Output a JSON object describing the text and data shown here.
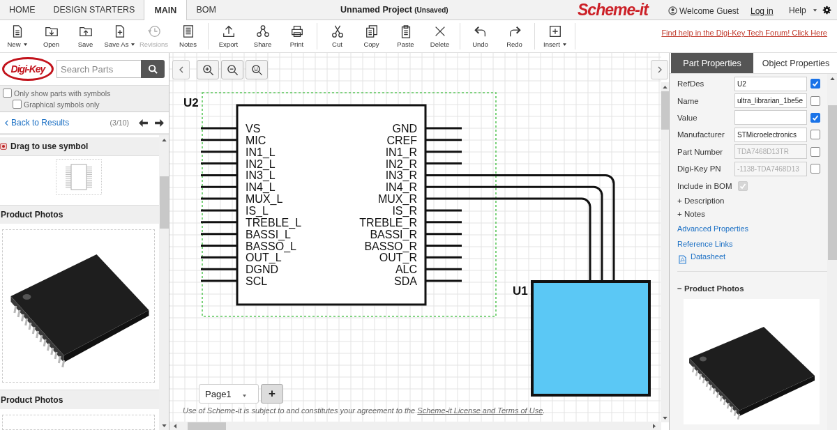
{
  "top_tabs": [
    {
      "label": "HOME",
      "selected": false
    },
    {
      "label": "DESIGN STARTERS",
      "selected": false
    },
    {
      "label": "MAIN",
      "selected": true
    },
    {
      "label": "BOM",
      "selected": false
    }
  ],
  "project": {
    "title": "Unnamed Project",
    "status": "(Unsaved)"
  },
  "app_logo": "Scheme-it",
  "user": {
    "welcome": "Welcome Guest",
    "login": "Log in",
    "help": "Help"
  },
  "toolbar": [
    [
      {
        "label": "New",
        "kind": "new",
        "has_menu": true,
        "disabled": false
      },
      {
        "label": "Open",
        "kind": "open",
        "has_menu": false,
        "disabled": false
      },
      {
        "label": "Save",
        "kind": "save",
        "has_menu": false,
        "disabled": false
      },
      {
        "label": "Save As",
        "kind": "saveas",
        "has_menu": true,
        "disabled": false
      },
      {
        "label": "Revisions",
        "kind": "revisions",
        "has_menu": false,
        "disabled": true
      },
      {
        "label": "Notes",
        "kind": "notes",
        "has_menu": false,
        "disabled": false
      }
    ],
    [
      {
        "label": "Export",
        "kind": "export",
        "has_menu": false,
        "disabled": false
      },
      {
        "label": "Share",
        "kind": "share",
        "has_menu": false,
        "disabled": false
      },
      {
        "label": "Print",
        "kind": "print",
        "has_menu": false,
        "disabled": false
      }
    ],
    [
      {
        "label": "Cut",
        "kind": "cut",
        "has_menu": false,
        "disabled": false
      },
      {
        "label": "Copy",
        "kind": "copy",
        "has_menu": false,
        "disabled": false
      },
      {
        "label": "Paste",
        "kind": "paste",
        "has_menu": false,
        "disabled": false
      },
      {
        "label": "Delete",
        "kind": "delete",
        "has_menu": false,
        "disabled": false
      }
    ],
    [
      {
        "label": "Undo",
        "kind": "undo",
        "has_menu": false,
        "disabled": false
      },
      {
        "label": "Redo",
        "kind": "redo",
        "has_menu": false,
        "disabled": false
      }
    ],
    [
      {
        "label": "Insert",
        "kind": "insert",
        "has_menu": true,
        "disabled": false
      }
    ]
  ],
  "forum_link": "Find help in the Digi-Key Tech Forum! Click Here",
  "sidebar": {
    "logo": "Digi-Key",
    "search": {
      "placeholder": "Search Parts"
    },
    "filters": [
      {
        "label": "Only show parts with symbols",
        "checked": false,
        "children": [
          {
            "label": "Graphical symbols only",
            "checked": false
          }
        ]
      }
    ],
    "back": "Back to Results",
    "count": "(3/10)",
    "symbol_section": "Drag to use symbol",
    "photo_sections": [
      "Product Photos",
      "Product Photos"
    ]
  },
  "canvas": {
    "parts": [
      {
        "ref": "U2",
        "kind": "ic",
        "selected": true,
        "pins_left": [
          "VS",
          "MIC",
          "IN1_L",
          "IN2_L",
          "IN3_L",
          "IN4_L",
          "MUX_L",
          "IS_L",
          "TREBLE_L",
          "BASSI_L",
          "BASSO_L",
          "OUT_L",
          "DGND",
          "SCL"
        ],
        "pins_right": [
          "GND",
          "CREF",
          "IN1_R",
          "IN2_R",
          "IN3_R",
          "IN4_R",
          "MUX_R",
          "IS_R",
          "TREBLE_R",
          "BASSI_R",
          "BASSO_R",
          "OUT_R",
          "ALC",
          "SDA"
        ]
      },
      {
        "ref": "U1",
        "kind": "block",
        "selected": false
      }
    ],
    "page_select": "Page1",
    "add_page": "+",
    "footer": {
      "before": "Use of Scheme-it is subject to and constitutes your agreement to the ",
      "link": "Scheme-it License and Terms of Use",
      "after": "."
    }
  },
  "properties": {
    "tabs": [
      {
        "label": "Part Properties",
        "selected": true
      },
      {
        "label": "Object Properties",
        "selected": false
      }
    ],
    "fields": [
      {
        "label": "RefDes",
        "value": "U2",
        "checked": true,
        "disabled": false
      },
      {
        "label": "Name",
        "value": "ultra_librarian_1be5e",
        "checked": false,
        "disabled": false
      },
      {
        "label": "Value",
        "checked": true,
        "disabled": false
      },
      {
        "label": "Manufacturer",
        "value": "STMicroelectronics",
        "checked": false,
        "disabled": false
      },
      {
        "label": "Part Number",
        "value": "TDA7468D13TR",
        "checked": false,
        "disabled": true
      },
      {
        "label": "Digi-Key PN",
        "value": "-1138-TDA7468D13",
        "checked": false,
        "disabled": true
      }
    ],
    "include_bom": {
      "label": "Include in BOM",
      "checked": true,
      "disabled": true
    },
    "expanders": [
      {
        "toggle": "+",
        "label": "Description"
      },
      {
        "toggle": "+",
        "label": "Notes"
      }
    ],
    "links": [
      "Advanced Properties",
      "Reference Links"
    ],
    "datasheet": "Datasheet",
    "photos": {
      "toggle": "−",
      "title": "Product Photos"
    }
  }
}
